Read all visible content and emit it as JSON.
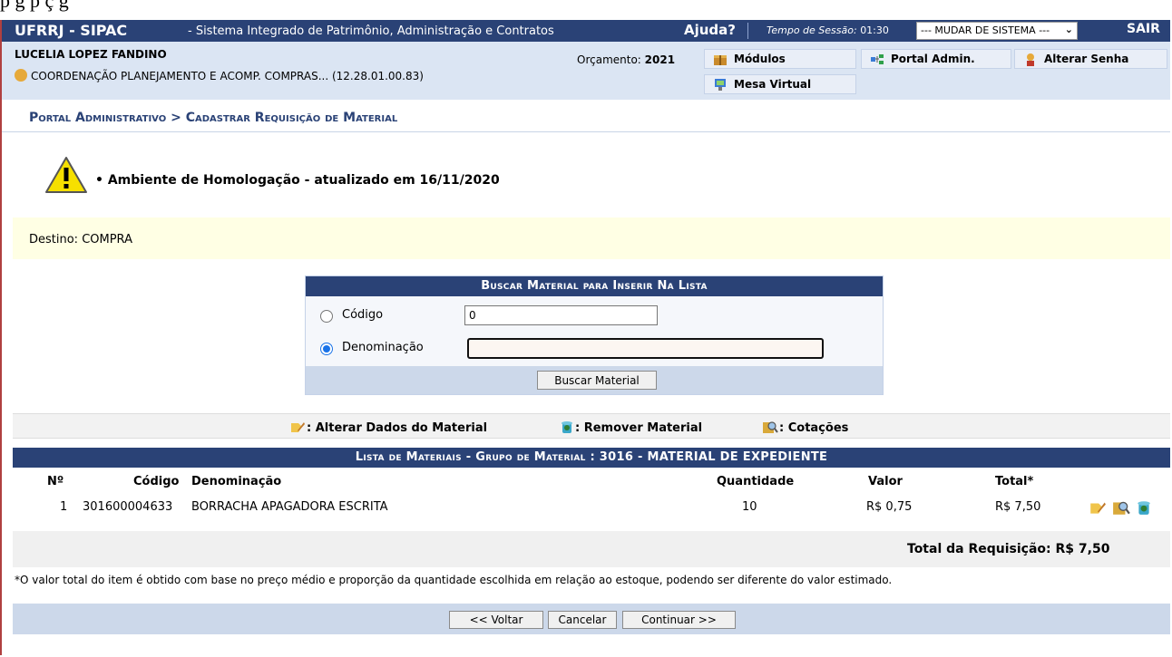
{
  "header": {
    "brand": "UFRRJ - SIPAC",
    "subtitle": "- Sistema Integrado de Patrimônio, Administração e Contratos",
    "help": "Ajuda?",
    "session_label": "Tempo de Sessão:",
    "session_time": "01:30",
    "system_select": "--- MUDAR DE SISTEMA ---",
    "logout": "SAIR"
  },
  "user": {
    "name": "LUCELIA LOPEZ FANDINO",
    "unit": "COORDENAÇÃO PLANEJAMENTO E ACOMP. COMPRAS... (12.28.01.00.83)",
    "budget_label": "Orçamento:",
    "budget_year": "2021"
  },
  "menu": {
    "modules": "Módulos",
    "portal_admin": "Portal Admin.",
    "change_password": "Alterar Senha",
    "virtual_desk": "Mesa Virtual"
  },
  "breadcrumb": "Portal Administrativo > Cadastrar Requisição de Material",
  "warning": "Ambiente de Homologação - atualizado em 16/11/2020",
  "destination": "Destino: COMPRA",
  "search": {
    "title": "Buscar Material para Inserir Na Lista",
    "code_label": "Código",
    "code_value": "0",
    "name_label": "Denominação",
    "name_value": "",
    "selected": "Denominação",
    "button": "Buscar Material"
  },
  "legend": {
    "edit": ": Alterar Dados do Material",
    "remove": ": Remover Material",
    "quotes": ": Cotações"
  },
  "materials": {
    "title": "Lista de Materiais - Grupo de Material : 3016 - MATERIAL DE EXPEDIENTE",
    "columns": {
      "num": "Nº",
      "code": "Código",
      "name": "Denominação",
      "qty": "Quantidade",
      "value": "Valor",
      "total": "Total*"
    },
    "rows": [
      {
        "num": "1",
        "code": "301600004633",
        "name": "BORRACHA APAGADORA ESCRITA",
        "qty": "10",
        "value": "R$ 0,75",
        "total": "R$ 7,50"
      }
    ],
    "grand_total": "Total da Requisição: R$ 7,50"
  },
  "note": "*O valor total do item é obtido com base no preço médio e proporção da quantidade escolhida em relação ao estoque, podendo ser diferente do valor estimado.",
  "buttons": {
    "back": "<< Voltar",
    "cancel": "Cancelar",
    "continue": "Continuar >>"
  },
  "colors": {
    "header_blue": "#2a4276",
    "user_bar": "#dbe5f3",
    "dest_bg": "#ffffe4"
  }
}
